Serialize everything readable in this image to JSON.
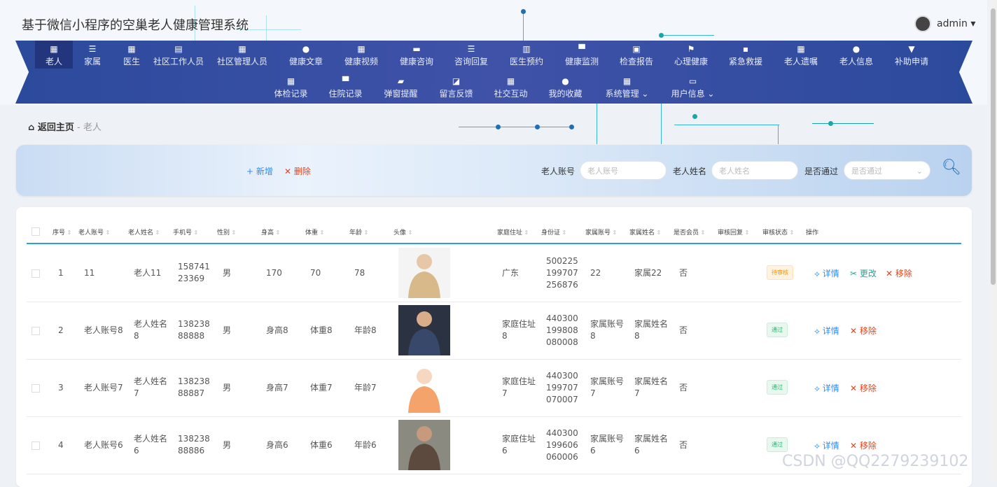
{
  "app": {
    "title": "基于微信小程序的空巢老人健康管理系统",
    "user": "admin ▾"
  },
  "nav": {
    "row1": [
      {
        "label": "老人",
        "icon": "grid-icon"
      },
      {
        "label": "家属",
        "icon": "list-icon"
      },
      {
        "label": "医生",
        "icon": "grid-icon"
      },
      {
        "label": "社区工作人员",
        "icon": "clipboard-icon"
      },
      {
        "label": "社区管理人员",
        "icon": "grid-icon"
      },
      {
        "label": "健康文章",
        "icon": "bulb-icon"
      },
      {
        "label": "健康视频",
        "icon": "grid-icon"
      },
      {
        "label": "健康咨询",
        "icon": "briefcase-icon"
      },
      {
        "label": "咨询回复",
        "icon": "list-icon"
      },
      {
        "label": "医生预约",
        "icon": "book-icon"
      },
      {
        "label": "健康监测",
        "icon": "monitor-icon"
      },
      {
        "label": "检查报告",
        "icon": "clipboard-x-icon"
      },
      {
        "label": "心理健康",
        "icon": "flag-icon"
      },
      {
        "label": "紧急救援",
        "icon": "chat-icon"
      },
      {
        "label": "老人遗嘱",
        "icon": "grid-icon"
      },
      {
        "label": "老人信息",
        "icon": "user-icon"
      },
      {
        "label": "补助申请",
        "icon": "sign-icon"
      }
    ],
    "row2": [
      {
        "label": "体检记录",
        "icon": "grid-icon"
      },
      {
        "label": "住院记录",
        "icon": "monitor-icon"
      },
      {
        "label": "弹窗提醒",
        "icon": "wallet-icon"
      },
      {
        "label": "留言反馈",
        "icon": "chart-icon"
      },
      {
        "label": "社交互动",
        "icon": "grid-icon"
      },
      {
        "label": "我的收藏",
        "icon": "user-icon"
      },
      {
        "label": "系统管理 ⌄",
        "icon": "grid-icon"
      },
      {
        "label": "用户信息 ⌄",
        "icon": "window-icon"
      }
    ]
  },
  "breadcrumb": {
    "home": "返回主页",
    "sep": "-",
    "current": "老人"
  },
  "toolbar": {
    "add": "+ 新增",
    "delete": "✕ 删除"
  },
  "search": {
    "account_label": "老人账号",
    "account_placeholder": "老人账号",
    "name_label": "老人姓名",
    "name_placeholder": "老人姓名",
    "pass_label": "是否通过",
    "pass_placeholder": "是否通过"
  },
  "table": {
    "headers": [
      "序号",
      "老人账号",
      "老人姓名",
      "手机号",
      "性别",
      "身高",
      "体重",
      "年龄",
      "头像",
      "家庭住址",
      "身份证",
      "家属账号",
      "家属姓名",
      "是否会员",
      "审核回复",
      "审核状态",
      "操作"
    ],
    "rows": [
      {
        "no": "1",
        "account": "11",
        "name": "老人11",
        "phone": "158741\n23369",
        "gender": "男",
        "height": "170",
        "weight": "70",
        "age": "78",
        "address": "广东",
        "idcard": "500225\n199707\n256876",
        "fam_account": "22",
        "fam_name": "家属22",
        "member": "否",
        "status": "待审核",
        "ops": [
          "⟡ 详情",
          "✂ 更改",
          "✕ 移除"
        ]
      },
      {
        "no": "2",
        "account": "老人账号8",
        "name": "老人姓名\n8",
        "phone": "138238\n88888",
        "gender": "男",
        "height": "身高8",
        "weight": "体重8",
        "age": "年龄8",
        "address": "家庭住址\n8",
        "idcard": "440300\n199808\n080008",
        "fam_account": "家属账号\n8",
        "fam_name": "家属姓名\n8",
        "member": "否",
        "status": "通过",
        "ops": [
          "⟡ 详情",
          "✕ 移除"
        ]
      },
      {
        "no": "3",
        "account": "老人账号7",
        "name": "老人姓名\n7",
        "phone": "138238\n88887",
        "gender": "男",
        "height": "身高7",
        "weight": "体重7",
        "age": "年龄7",
        "address": "家庭住址\n7",
        "idcard": "440300\n199707\n070007",
        "fam_account": "家属账号\n7",
        "fam_name": "家属姓名\n7",
        "member": "否",
        "status": "通过",
        "ops": [
          "⟡ 详情",
          "✕ 移除"
        ]
      },
      {
        "no": "4",
        "account": "老人账号6",
        "name": "老人姓名\n6",
        "phone": "138238\n88886",
        "gender": "男",
        "height": "身高6",
        "weight": "体重6",
        "age": "年龄6",
        "address": "家庭住址\n6",
        "idcard": "440300\n199606\n060006",
        "fam_account": "家属账号\n6",
        "fam_name": "家属姓名\n6",
        "member": "否",
        "status": "通过",
        "ops": [
          "⟡ 详情",
          "✕ 移除"
        ]
      }
    ]
  },
  "watermark": "CSDN @QQ2279239102",
  "colors": {
    "nav": "#3f52a8",
    "accent": "#2aa5c9",
    "pending": "#f29100",
    "ok": "#19be6b",
    "danger": "#ed4014",
    "link": "#2d8cf0"
  }
}
